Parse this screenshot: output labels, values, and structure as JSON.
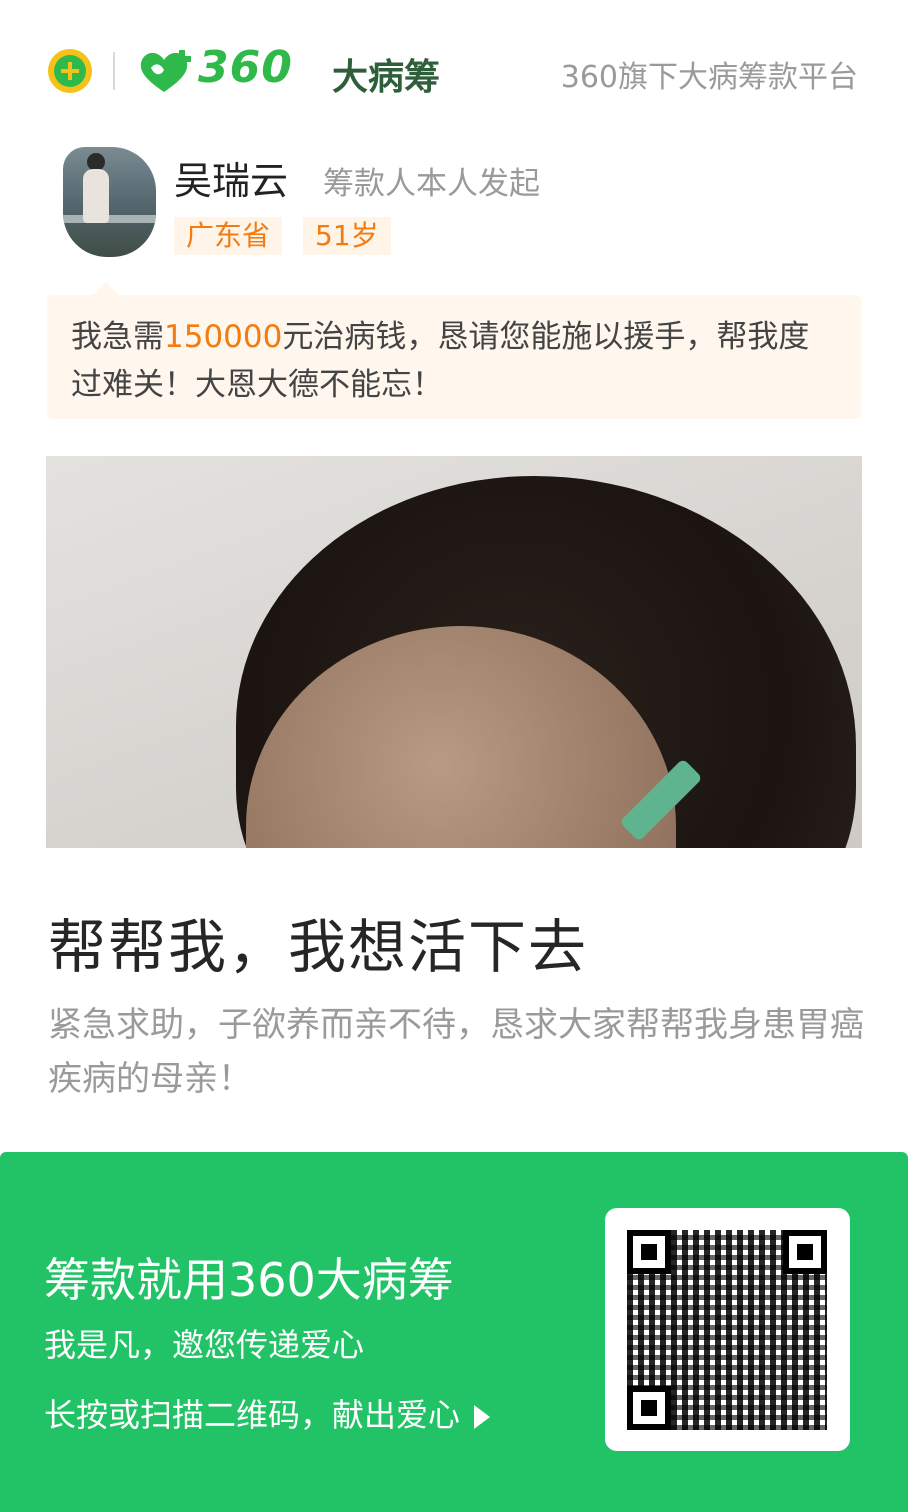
{
  "header": {
    "brand_number": "360",
    "brand_name": "大病筹",
    "tagline": "360旗下大病筹款平台"
  },
  "profile": {
    "name": "吴瑞云",
    "initiator": "筹款人本人发起",
    "province": "广东省",
    "age": "51岁"
  },
  "appeal": {
    "prefix": "我急需",
    "amount": "150000",
    "suffix": "元治病钱，恳请您能施以援手，帮我度过难关！大恩大德不能忘！"
  },
  "story": {
    "title": "帮帮我，我想活下去",
    "description": "紧急求助，子欲养而亲不待，恳求大家帮帮我身患胃癌疾病的母亲！"
  },
  "footer": {
    "title": "筹款就用360大病筹",
    "invite": "我是凡，邀您传递爱心",
    "cta": "长按或扫描二维码，献出爱心"
  },
  "colors": {
    "brand_green": "#22c267",
    "accent_orange": "#f37b0f"
  }
}
